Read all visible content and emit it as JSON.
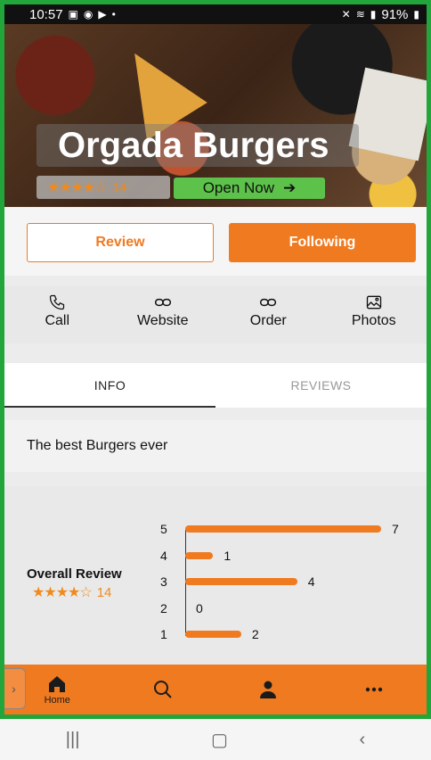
{
  "status_bar": {
    "time": "10:57",
    "battery": "91%"
  },
  "restaurant": {
    "name": "Orgada Burgers",
    "stars": "★★★★☆",
    "rating_count": "14",
    "open_status": "Open Now"
  },
  "actions": {
    "review_label": "Review",
    "following_label": "Following"
  },
  "quick_actions": {
    "call": "Call",
    "website": "Website",
    "order": "Order",
    "photos": "Photos"
  },
  "tabs": {
    "info": "INFO",
    "reviews": "REVIEWS"
  },
  "description": "The best Burgers ever",
  "review_summary": {
    "title": "Overall Review",
    "stars": "★★★★☆",
    "count": "14",
    "distribution": [
      {
        "stars": "5",
        "count": 7
      },
      {
        "stars": "4",
        "count": 1
      },
      {
        "stars": "3",
        "count": 4
      },
      {
        "stars": "2",
        "count": 0
      },
      {
        "stars": "1",
        "count": 2
      }
    ]
  },
  "bottom_nav": {
    "home": "Home"
  },
  "colors": {
    "accent": "#f07a20",
    "open_green": "#5cc24a",
    "frame_green": "#22a53a"
  },
  "icons": [
    "image-icon",
    "app-icon",
    "youtube-icon",
    "mute-icon",
    "wifi-icon",
    "signal-icon",
    "battery-icon",
    "phone-icon",
    "link-icon",
    "photos-icon",
    "home-icon",
    "search-icon",
    "person-icon",
    "more-icon",
    "recents-icon",
    "home-circle-icon",
    "back-icon"
  ]
}
